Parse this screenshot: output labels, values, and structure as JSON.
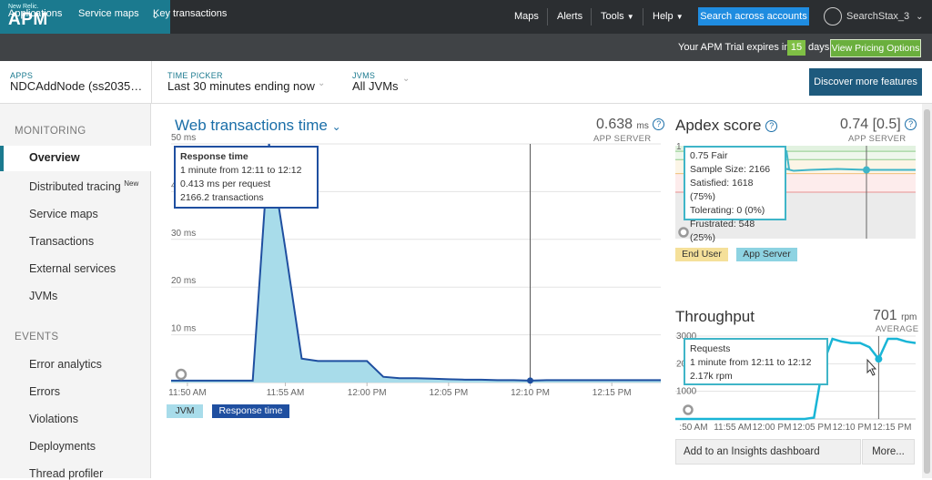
{
  "brand": {
    "small": "New Relic.",
    "name": "APM"
  },
  "topnav": {
    "maps": "Maps",
    "alerts": "Alerts",
    "tools": "Tools",
    "help": "Help",
    "search": "Search across accounts",
    "user": "SearchStax_3"
  },
  "subnav": {
    "applications": "Applications",
    "service_maps": "Service maps",
    "key_transactions": "Key transactions"
  },
  "trial": {
    "prefix": "Your APM Trial expires in",
    "days": "15",
    "suffix": "days",
    "pricing": "View Pricing Options"
  },
  "context": {
    "apps_label": "APPS",
    "apps_value": "NDCAddNode (ss2035…",
    "time_label": "TIME PICKER",
    "time_value": "Last 30 minutes ending now",
    "jvms_label": "JVMS",
    "jvms_value": "All JVMs",
    "discover": "Discover more features"
  },
  "sidebar": {
    "monitoring": "MONITORING",
    "overview": "Overview",
    "distributed": "Distributed tracing",
    "new_badge": "New",
    "service_maps": "Service maps",
    "transactions": "Transactions",
    "external": "External services",
    "jvms": "JVMs",
    "events": "EVENTS",
    "error_analytics": "Error analytics",
    "errors": "Errors",
    "violations": "Violations",
    "deployments": "Deployments",
    "thread_profiler": "Thread profiler"
  },
  "web": {
    "title": "Web transactions time",
    "metric": "0.638",
    "metric_unit": "ms",
    "metric_sub": "APP SERVER",
    "tooltip": {
      "title": "Response time",
      "line1": "1 minute from 12:11 to 12:12",
      "line2": "0.413 ms per request",
      "line3": "2166.2 transactions"
    },
    "legend_jvm": "JVM",
    "legend_rt": "Response time"
  },
  "apdex": {
    "title": "Apdex score",
    "metric": "0.74 [0.5]",
    "metric_sub": "APP SERVER",
    "tooltip": {
      "line1": "0.75 Fair",
      "line2": "Sample Size: 2166",
      "line3": "Satisfied: 1618 (75%)",
      "line4": "Tolerating: 0 (0%)",
      "line5": "Frustrated: 548 (25%)"
    },
    "legend_end_user": "End User",
    "legend_app_server": "App Server"
  },
  "throughput": {
    "title": "Throughput",
    "metric": "701",
    "metric_unit": "rpm",
    "metric_sub": "AVERAGE",
    "tooltip": {
      "title": "Requests",
      "line1": "1 minute from 12:11 to 12:12",
      "line2": "2.17k rpm"
    },
    "insights": "Add to an Insights dashboard",
    "more": "More..."
  },
  "colors": {
    "teal": "#1b7a8f",
    "chart_fill": "#a8dcea",
    "chart_line": "#1f4fa0",
    "throughput_line": "#19b5d6",
    "apdex_line": "#3fb5c8"
  },
  "chart_data": [
    {
      "type": "area",
      "title": "Web transactions time",
      "ylabel": "ms",
      "y_ticks": [
        "10 ms",
        "20 ms",
        "30 ms",
        "40 ms",
        "50 ms"
      ],
      "x_ticks": [
        "11:50 AM",
        "11:55 AM",
        "12:00 PM",
        "12:05 PM",
        "12:10 PM",
        "12:15 PM"
      ],
      "ylim": [
        0,
        50
      ],
      "series": [
        {
          "name": "Response time",
          "x": [
            "11:49",
            "11:50",
            "11:51",
            "11:52",
            "11:53",
            "11:54",
            "11:55",
            "11:56",
            "11:57",
            "11:58",
            "11:59",
            "12:00",
            "12:01",
            "12:02",
            "12:03",
            "12:04",
            "12:05",
            "12:06",
            "12:07",
            "12:08",
            "12:09",
            "12:10",
            "12:11",
            "12:12",
            "12:13",
            "12:14",
            "12:15",
            "12:16",
            "12:17",
            "12:18",
            "12:19"
          ],
          "values": [
            0.4,
            0.4,
            0.4,
            0.4,
            0.4,
            0.4,
            50,
            28,
            5,
            4.5,
            4.5,
            4.5,
            4.5,
            1.2,
            0.9,
            0.9,
            0.8,
            0.7,
            0.6,
            0.6,
            0.5,
            0.5,
            0.413,
            0.5,
            0.5,
            0.5,
            0.5,
            0.5,
            0.5,
            0.5,
            0.5
          ]
        }
      ]
    },
    {
      "type": "line",
      "title": "Apdex score",
      "y_ticks": [
        "1"
      ],
      "ylim": [
        0,
        1
      ],
      "series": [
        {
          "name": "App Server",
          "values": [
            0.75,
            0.73,
            0.74,
            0.75,
            0.74,
            0.74,
            0.74
          ]
        }
      ]
    },
    {
      "type": "line",
      "title": "Throughput",
      "ylabel": "rpm",
      "y_ticks": [
        "1000",
        "2000",
        "3000"
      ],
      "x_ticks": [
        ":50 AM",
        "11:55 AM",
        "12:00 PM",
        "12:05 PM",
        "12:10 PM",
        "12:15 PM"
      ],
      "ylim": [
        0,
        3000
      ],
      "series": [
        {
          "name": "Requests",
          "values": [
            0,
            0,
            0,
            0,
            0,
            0,
            0,
            0,
            0,
            0,
            0,
            0,
            0,
            0,
            0,
            50,
            2000,
            2900,
            2800,
            2750,
            2750,
            2600,
            2170,
            2900,
            2900,
            2800,
            2750
          ]
        }
      ]
    }
  ]
}
